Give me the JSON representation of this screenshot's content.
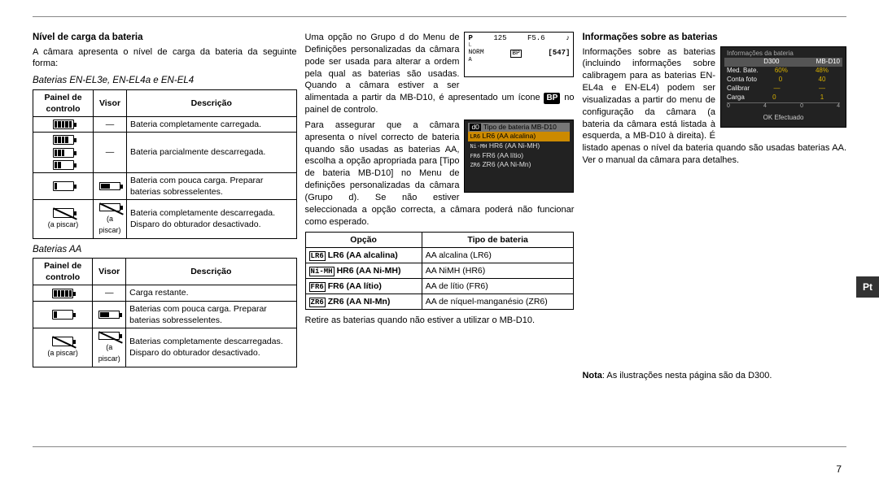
{
  "lang_tab": "Pt",
  "page_number": "7",
  "col1": {
    "h_battery_level": "Nível de carga da bateria",
    "intro": "A câmara apresenta o nível de carga da bateria da seguinte forma:",
    "sub_enel": "Baterias EN-EL3e, EN-EL4a e EN-EL4",
    "th_cp": "Painel de controlo",
    "th_vf": "Visor",
    "th_desc": "Descrição",
    "t1r1_desc": "Bateria completamente carregada.",
    "t1r2_desc": "Bateria parcialmente descarregada.",
    "t1r3_desc": "Bateria com pouca carga. Preparar baterias sobresselentes.",
    "t1r4_desc": "Bateria completamente descarregada. Disparo do obturador desactivado.",
    "blink": "(a piscar)",
    "dash": "—",
    "sub_aa": "Baterias AA",
    "t2r1_desc": "Carga restante.",
    "t2r2_desc": "Baterias com pouca carga. Preparar baterias sobresselentes.",
    "t2r3_desc": "Baterias completamente descarregadas. Disparo do obturador desactivado."
  },
  "col2": {
    "lcd": {
      "p": "P",
      "shutter": "125",
      "f": "F5.6",
      "A": "A",
      "count": "547"
    },
    "para1": "Uma opção no Grupo d do Menu de Definições personalizadas da câmara pode ser usada para alterar a ordem pela qual as baterias são usadas. Quando a câmara estiver a ser alimentada a partir da MB-D10, é apresentado um ícone ",
    "para1_after": " no painel de controlo.",
    "bp_label": "BP",
    "menu": {
      "hdr_icon": "d0",
      "hdr": "Tipo de bateria MB-D10",
      "items": [
        "LR6 (AA alcalina)",
        "HR6 (AA Ni-MH)",
        "FR6 (AA lítio)",
        "ZR6 (AA Ni-Mn)"
      ],
      "prefixes": [
        "LR6",
        "Ni-MH",
        "FR6",
        "ZR6"
      ]
    },
    "para2": "Para assegurar que a câmara apresenta o nível correcto de bateria quando são usadas as baterias AA, escolha a opção apropriada para [Tipo de bateria MB-D10] no Menu de definições personalizadas da câmara (Grupo d). Se não estiver seleccionada a opção correcta, a câmara poderá não funcionar como esperado.",
    "th_opcao": "Opção",
    "th_tipo": "Tipo de bateria",
    "opts": [
      {
        "pre": "LR6",
        "label": "LR6 (AA alcalina)",
        "type": "AA alcalina (LR6)"
      },
      {
        "pre": "Ni-MH",
        "label": "HR6 (AA Ni-MH)",
        "type": "AA NiMH (HR6)"
      },
      {
        "pre": "FR6",
        "label": "FR6 (AA lítio)",
        "type": "AA de lítio (FR6)"
      },
      {
        "pre": "ZR6",
        "label": "ZR6 (AA NI-Mn)",
        "type": "AA de níquel-manganésio (ZR6)"
      }
    ],
    "remove": "Retire as baterias quando não estiver a utilizar o MB-D10."
  },
  "col3": {
    "h_info": "Informações sobre as baterias",
    "info_img": {
      "title": "Informações da bateria",
      "cols": [
        "",
        "D300",
        "MB-D10"
      ],
      "rows": [
        {
          "l": "Med. Bate.",
          "a": "60%",
          "b": "48%"
        },
        {
          "l": "Conta foto",
          "a": "0",
          "b": "40"
        },
        {
          "l": "Calibrar",
          "a": "—",
          "b": "—"
        },
        {
          "l": "Carga",
          "a": "0",
          "b": "1"
        }
      ],
      "scale": [
        "0",
        "4",
        "0",
        "4"
      ],
      "ok": "OK Efectuado"
    },
    "para": "Informações sobre as baterias (incluindo informações sobre calibragem para as baterias EN-EL4a e EN-EL4) podem ser visualizadas a partir do menu de configuração da câmara (a bateria da câmara está listada à esquerda, a MB-D10 à direita). É listado apenas o nível da bateria quando são usadas baterias AA. Ver o manual da câmara para detalhes.",
    "note_label": "Nota",
    "note": ": As ilustrações nesta página são da D300."
  }
}
